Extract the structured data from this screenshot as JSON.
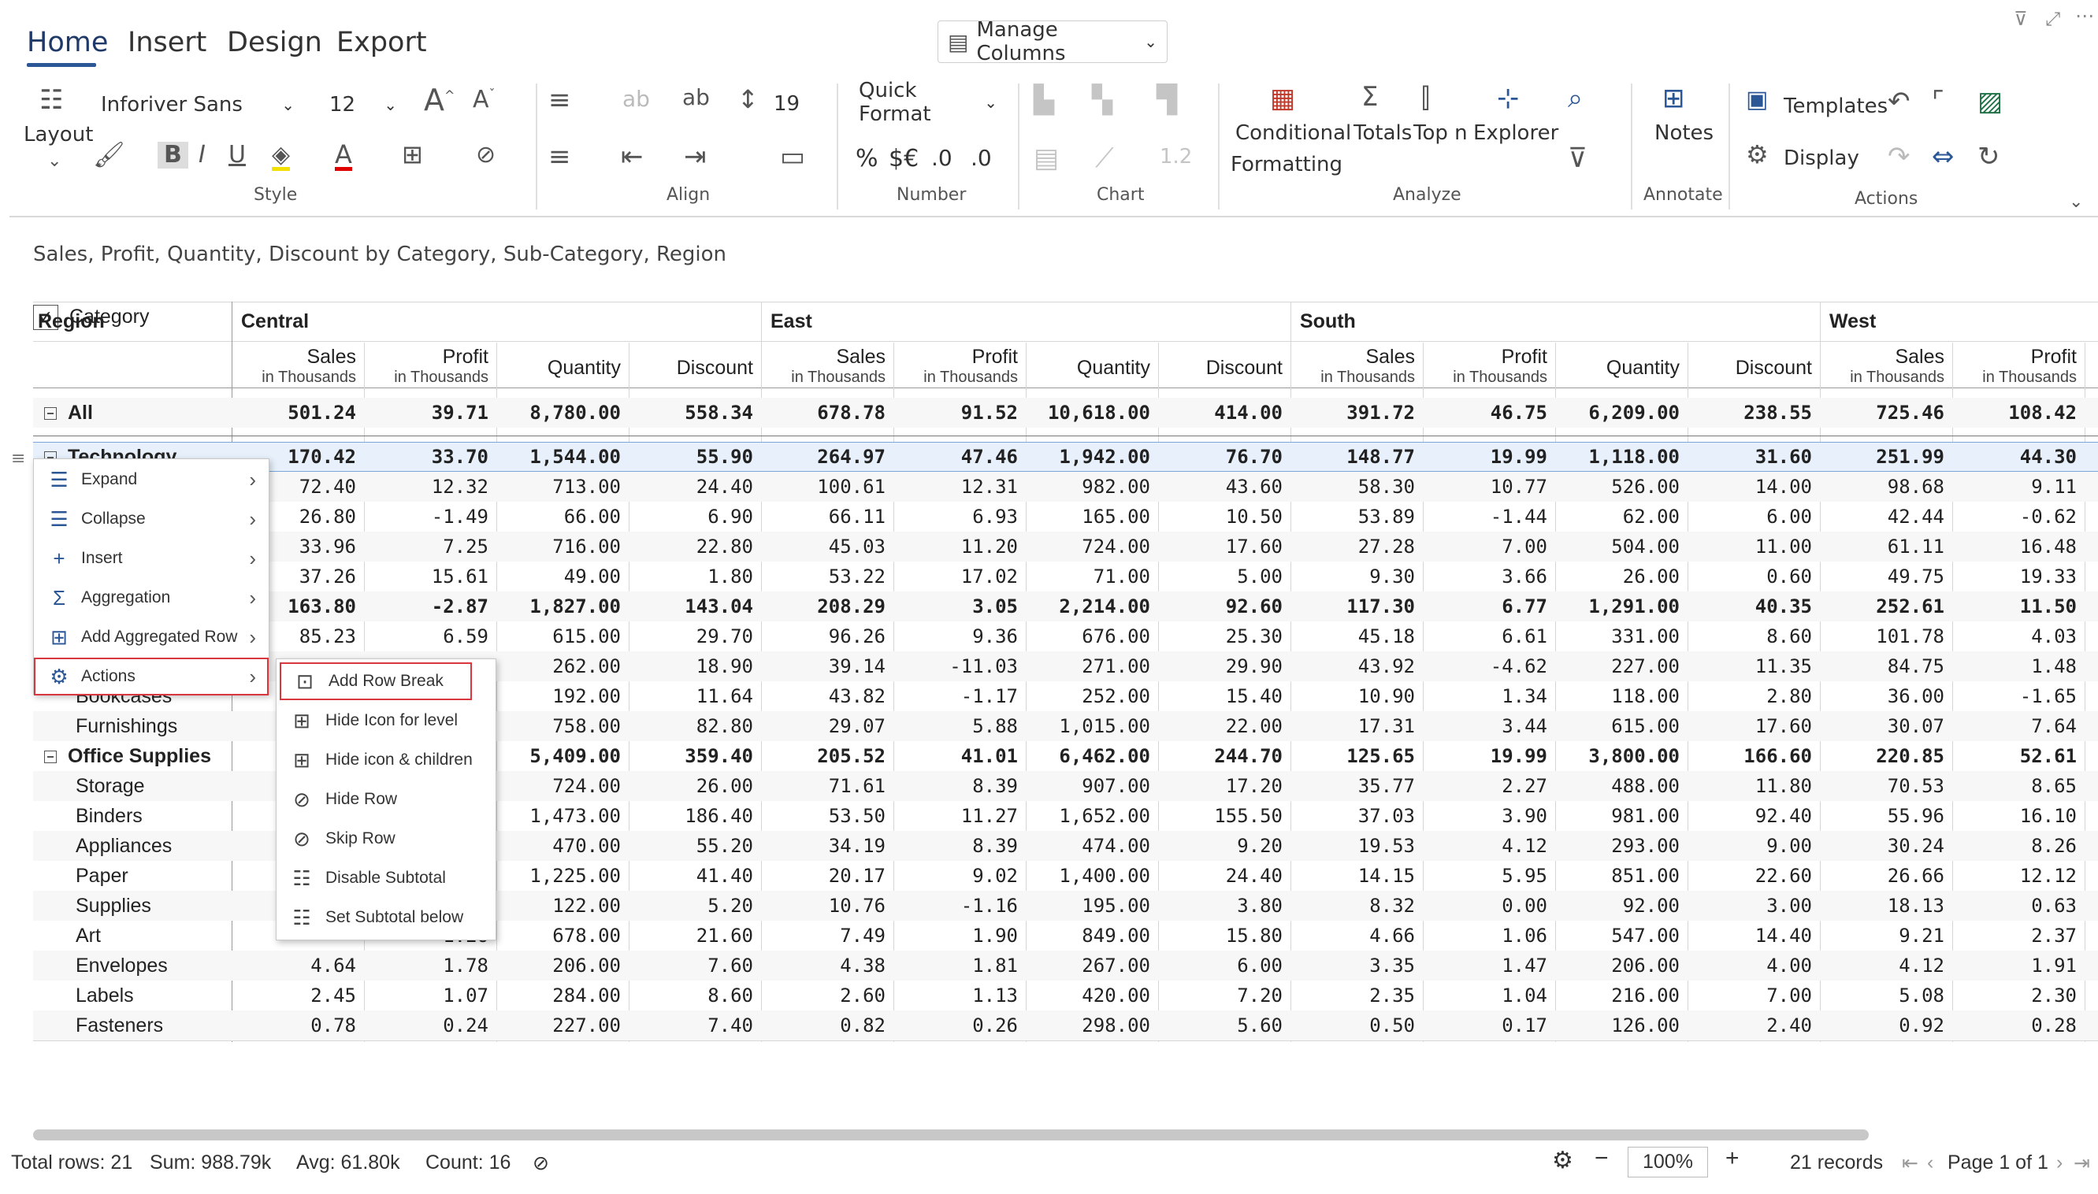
{
  "tabs": [
    "Home",
    "Insert",
    "Design",
    "Export"
  ],
  "manage_columns": "Manage Columns",
  "ribbon": {
    "layout": "Layout",
    "font_name": "Inforiver Sans",
    "font_size": "12",
    "line_height": "19",
    "number_format": "Quick Format",
    "style_group": "Style",
    "align_group": "Align",
    "number_group": "Number",
    "chart_group": "Chart",
    "analyze_group": "Analyze",
    "annotate_group": "Annotate",
    "actions_group": "Actions",
    "conditional": "Conditional",
    "formatting": "Formatting",
    "totals": "Totals",
    "topn": "Top n",
    "explorer": "Explorer",
    "notes": "Notes",
    "templates": "Templates",
    "display": "Display",
    "bold": "B",
    "italic": "I",
    "underline": "U",
    "percent": "%",
    "currency": "$€",
    "dec_inc": ".0",
    "dec_dec": ".0",
    "chart_value": "1.2"
  },
  "subtitle": "Sales, Profit, Quantity, Discount by Category, Sub-Category, Region",
  "grid": {
    "region_label": "Region",
    "category_label": "Category",
    "regions": [
      "Central",
      "East",
      "South",
      "West"
    ],
    "measures": [
      {
        "name": "Sales",
        "unit": "in Thousands"
      },
      {
        "name": "Profit",
        "unit": "in Thousands"
      },
      {
        "name": "Quantity",
        "unit": ""
      },
      {
        "name": "Discount",
        "unit": ""
      }
    ],
    "rows": [
      {
        "label": "All",
        "level": 0,
        "bold": true,
        "values": [
          "501.24",
          "39.71",
          "8,780.00",
          "558.34",
          "678.78",
          "91.52",
          "10,618.00",
          "414.00",
          "391.72",
          "46.75",
          "6,209.00",
          "238.55",
          "725.46",
          "108.42"
        ]
      },
      {
        "label": "Technology",
        "level": 0,
        "bold": true,
        "values": [
          "170.42",
          "33.70",
          "1,544.00",
          "55.90",
          "264.97",
          "47.46",
          "1,942.00",
          "76.70",
          "148.77",
          "19.99",
          "1,118.00",
          "31.60",
          "251.99",
          "44.30"
        ]
      },
      {
        "label": "",
        "level": 1,
        "values": [
          "72.40",
          "12.32",
          "713.00",
          "24.40",
          "100.61",
          "12.31",
          "982.00",
          "43.60",
          "58.30",
          "10.77",
          "526.00",
          "14.00",
          "98.68",
          "9.11"
        ]
      },
      {
        "label": "",
        "level": 1,
        "values": [
          "26.80",
          "-1.49",
          "66.00",
          "6.90",
          "66.11",
          "6.93",
          "165.00",
          "10.50",
          "53.89",
          "-1.44",
          "62.00",
          "6.00",
          "42.44",
          "-0.62"
        ]
      },
      {
        "label": "",
        "level": 1,
        "values": [
          "33.96",
          "7.25",
          "716.00",
          "22.80",
          "45.03",
          "11.20",
          "724.00",
          "17.60",
          "27.28",
          "7.00",
          "504.00",
          "11.00",
          "61.11",
          "16.48"
        ]
      },
      {
        "label": "",
        "level": 1,
        "values": [
          "37.26",
          "15.61",
          "49.00",
          "1.80",
          "53.22",
          "17.02",
          "71.00",
          "5.00",
          "9.30",
          "3.66",
          "26.00",
          "0.60",
          "49.75",
          "19.33"
        ]
      },
      {
        "label": "",
        "level": 0,
        "bold": true,
        "values": [
          "163.80",
          "-2.87",
          "1,827.00",
          "143.04",
          "208.29",
          "3.05",
          "2,214.00",
          "92.60",
          "117.30",
          "6.77",
          "1,291.00",
          "40.35",
          "252.61",
          "11.50"
        ]
      },
      {
        "label": "",
        "level": 1,
        "values": [
          "85.23",
          "6.59",
          "615.00",
          "29.70",
          "96.26",
          "9.36",
          "676.00",
          "25.30",
          "45.18",
          "6.61",
          "331.00",
          "8.60",
          "101.78",
          "4.03"
        ]
      },
      {
        "label": "",
        "level": 1,
        "values": [
          "",
          "",
          "262.00",
          "18.90",
          "39.14",
          "-11.03",
          "271.00",
          "29.90",
          "43.92",
          "-4.62",
          "227.00",
          "11.35",
          "84.75",
          "1.48"
        ]
      },
      {
        "label": "Bookcases",
        "level": 1,
        "values": [
          "",
          "",
          "192.00",
          "11.64",
          "43.82",
          "-1.17",
          "252.00",
          "15.40",
          "10.90",
          "1.34",
          "118.00",
          "2.80",
          "36.00",
          "-1.65"
        ]
      },
      {
        "label": "Furnishings",
        "level": 1,
        "values": [
          "",
          "",
          "758.00",
          "82.80",
          "29.07",
          "5.88",
          "1,015.00",
          "22.00",
          "17.31",
          "3.44",
          "615.00",
          "17.60",
          "30.07",
          "7.64"
        ]
      },
      {
        "label": "Office Supplies",
        "level": 0,
        "bold": true,
        "values": [
          "",
          "",
          "5,409.00",
          "359.40",
          "205.52",
          "41.01",
          "6,462.00",
          "244.70",
          "125.65",
          "19.99",
          "3,800.00",
          "166.60",
          "220.85",
          "52.61"
        ]
      },
      {
        "label": "Storage",
        "level": 1,
        "values": [
          "",
          "",
          "724.00",
          "26.00",
          "71.61",
          "8.39",
          "907.00",
          "17.20",
          "35.77",
          "2.27",
          "488.00",
          "11.80",
          "70.53",
          "8.65"
        ]
      },
      {
        "label": "Binders",
        "level": 1,
        "values": [
          "",
          "",
          "1,473.00",
          "186.40",
          "53.50",
          "11.27",
          "1,652.00",
          "155.50",
          "37.03",
          "3.90",
          "981.00",
          "92.40",
          "55.96",
          "16.10"
        ]
      },
      {
        "label": "Appliances",
        "level": 1,
        "values": [
          "",
          "",
          "470.00",
          "55.20",
          "34.19",
          "8.39",
          "474.00",
          "9.20",
          "19.53",
          "4.12",
          "293.00",
          "9.00",
          "30.24",
          "8.26"
        ]
      },
      {
        "label": "Paper",
        "level": 1,
        "values": [
          "",
          "",
          "1,225.00",
          "41.40",
          "20.17",
          "9.02",
          "1,400.00",
          "24.40",
          "14.15",
          "5.95",
          "851.00",
          "22.60",
          "26.66",
          "12.12"
        ]
      },
      {
        "label": "Supplies",
        "level": 1,
        "values": [
          "",
          "",
          "122.00",
          "5.20",
          "10.76",
          "-1.16",
          "195.00",
          "3.80",
          "8.32",
          "0.00",
          "92.00",
          "3.00",
          "18.13",
          "0.63"
        ]
      },
      {
        "label": "Art",
        "level": 1,
        "values": [
          "",
          "1.26",
          "678.00",
          "21.60",
          "7.49",
          "1.90",
          "849.00",
          "15.80",
          "4.66",
          "1.06",
          "547.00",
          "14.40",
          "9.21",
          "2.37"
        ]
      },
      {
        "label": "Envelopes",
        "level": 1,
        "values": [
          "4.64",
          "1.78",
          "206.00",
          "7.60",
          "4.38",
          "1.81",
          "267.00",
          "6.00",
          "3.35",
          "1.47",
          "206.00",
          "4.00",
          "4.12",
          "1.91"
        ]
      },
      {
        "label": "Labels",
        "level": 1,
        "values": [
          "2.45",
          "1.07",
          "284.00",
          "8.60",
          "2.60",
          "1.13",
          "420.00",
          "7.20",
          "2.35",
          "1.04",
          "216.00",
          "7.00",
          "5.08",
          "2.30"
        ]
      },
      {
        "label": "Fasteners",
        "level": 1,
        "values": [
          "0.78",
          "0.24",
          "227.00",
          "7.40",
          "0.82",
          "0.26",
          "298.00",
          "5.60",
          "0.50",
          "0.17",
          "126.00",
          "2.40",
          "0.92",
          "0.28"
        ]
      }
    ]
  },
  "context_menu": {
    "items": [
      {
        "label": "Expand",
        "icon": "expand-icon"
      },
      {
        "label": "Collapse",
        "icon": "collapse-icon"
      },
      {
        "label": "Insert",
        "icon": "plus-icon"
      },
      {
        "label": "Aggregation",
        "icon": "sigma-icon"
      },
      {
        "label": "Add Aggregated Row",
        "icon": "aggregated-row-icon"
      },
      {
        "label": "Actions",
        "icon": "gear-icon"
      }
    ]
  },
  "actions_submenu": {
    "items": [
      {
        "label": "Add Row Break",
        "icon": "row-break-icon"
      },
      {
        "label": "Hide Icon for level",
        "icon": "hide-icon-level-icon"
      },
      {
        "label": "Hide icon & children",
        "icon": "hide-children-icon"
      },
      {
        "label": "Hide Row",
        "icon": "eye-off-icon"
      },
      {
        "label": "Skip Row",
        "icon": "eye-skip-icon"
      },
      {
        "label": "Disable Subtotal",
        "icon": "list-icon"
      },
      {
        "label": "Set Subtotal below",
        "icon": "list-below-icon"
      }
    ]
  },
  "status": {
    "total_rows": "Total rows: 21",
    "sum": "Sum: 988.79k",
    "avg": "Avg: 61.80k",
    "count": "Count: 16",
    "zoom": "100%",
    "records": "21 records",
    "page": "Page 1 of 1"
  },
  "colors": {
    "accent": "#2b5797",
    "highlight_border": "#d9363e",
    "selected_row": "#e8f1fb"
  }
}
